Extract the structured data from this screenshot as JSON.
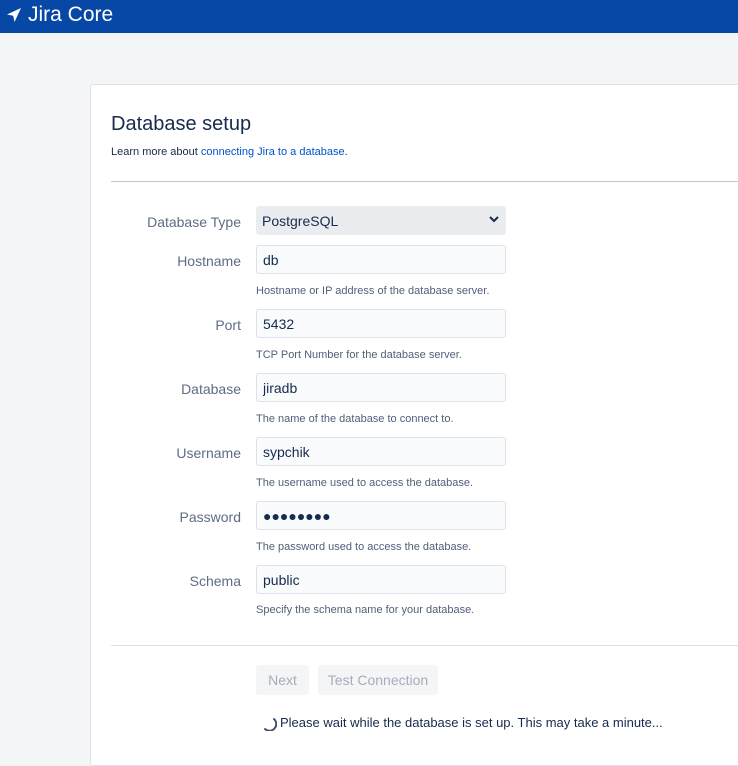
{
  "app": {
    "name": "Jira Core"
  },
  "page": {
    "title": "Database setup",
    "learn_prefix": "Learn more about ",
    "learn_link": "connecting Jira to a database",
    "learn_suffix": "."
  },
  "form": {
    "database_type": {
      "label": "Database Type",
      "value": "PostgreSQL"
    },
    "hostname": {
      "label": "Hostname",
      "value": "db",
      "help": "Hostname or IP address of the database server."
    },
    "port": {
      "label": "Port",
      "value": "5432",
      "help": "TCP Port Number for the database server."
    },
    "database": {
      "label": "Database",
      "value": "jiradb",
      "help": "The name of the database to connect to."
    },
    "username": {
      "label": "Username",
      "value": "sypchik",
      "help": "The username used to access the database."
    },
    "password": {
      "label": "Password",
      "value": "●●●●●●●●",
      "help": "The password used to access the database."
    },
    "schema": {
      "label": "Schema",
      "value": "public",
      "help": "Specify the schema name for your database."
    }
  },
  "buttons": {
    "next": "Next",
    "test_connection": "Test Connection"
  },
  "status": {
    "message": "Please wait while the database is set up. This may take a minute..."
  },
  "colors": {
    "header": "#0747a6",
    "link": "#0052cc"
  }
}
